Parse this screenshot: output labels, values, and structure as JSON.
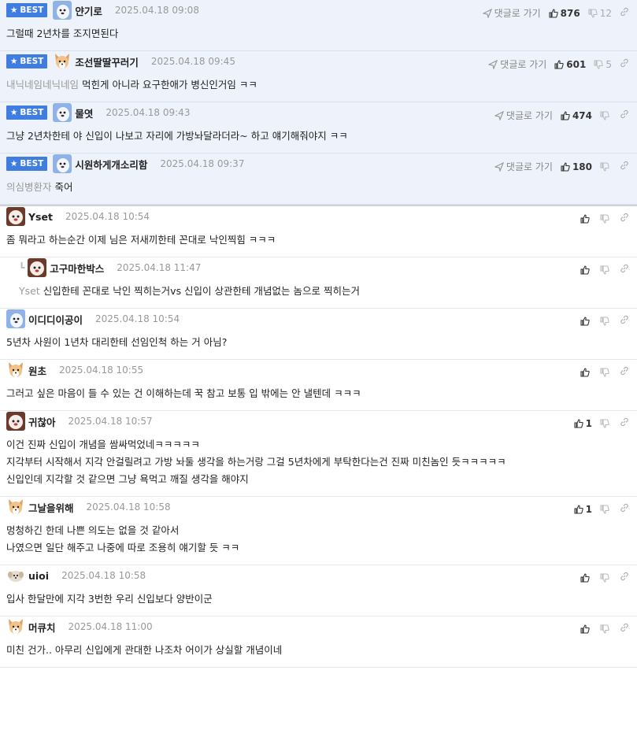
{
  "ui": {
    "best_label": "BEST",
    "goto_label": "댓글로 가기"
  },
  "comments": [
    {
      "best": true,
      "avatar": "blue",
      "nick": "얀기로",
      "date": "2025.04.18 09:08",
      "likes": "876",
      "dislikes": "12",
      "quote": "",
      "lines": [
        "그럴때 2년차를 조지면된다"
      ]
    },
    {
      "best": true,
      "avatar": "dog",
      "nick": "조선딸딸꾸러기",
      "date": "2025.04.18 09:45",
      "likes": "601",
      "dislikes": "5",
      "quote": "내닉네임네닉네임",
      "lines": [
        "먹힌게 아니라 요구한애가 병신인거임 ㅋㅋ"
      ]
    },
    {
      "best": true,
      "avatar": "blue",
      "nick": "물엿",
      "date": "2025.04.18 09:43",
      "likes": "474",
      "dislikes": "",
      "quote": "",
      "lines": [
        "그냥 2년차한테 야 신입이 나보고 자리에 가방놔달라더라~ 하고 얘기해줘야지 ㅋㅋ"
      ]
    },
    {
      "best": true,
      "avatar": "blue",
      "nick": "시원하게개소리함",
      "date": "2025.04.18 09:37",
      "likes": "180",
      "dislikes": "",
      "quote": "의심병환자",
      "lines": [
        "죽어"
      ]
    },
    {
      "best": false,
      "avatar": "poodle",
      "nick": "Yset",
      "date": "2025.04.18 10:54",
      "likes": "",
      "dislikes": "",
      "quote": "",
      "lines": [
        "좀 뭐라고 하는순간 이제 님은 저새끼한테 꼰대로 낙인찍힘 ㅋㅋㅋ"
      ]
    },
    {
      "best": false,
      "reply": true,
      "avatar": "poodle",
      "nick": "고구마한박스",
      "date": "2025.04.18 11:47",
      "likes": "",
      "dislikes": "",
      "quote": "Yset",
      "lines": [
        "신입한테 꼰대로 낙인 찍히는거vs 신입이 상관한테 개념없는 놈으로 찍히는거"
      ]
    },
    {
      "best": false,
      "avatar": "blue",
      "nick": "이디디이공이",
      "date": "2025.04.18 10:54",
      "likes": "",
      "dislikes": "",
      "quote": "",
      "lines": [
        "5년차 사원이 1년차 대리한테 선임인척 하는 거 아님?"
      ]
    },
    {
      "best": false,
      "avatar": "dog",
      "nick": "원초",
      "date": "2025.04.18 10:55",
      "likes": "",
      "dislikes": "",
      "quote": "",
      "lines": [
        "그러고 싶은 마음이 들 수 있는 건 이해하는데 꾹 참고 보통 입 밖에는 안 낼텐데 ㅋㅋㅋ"
      ]
    },
    {
      "best": false,
      "avatar": "poodle",
      "nick": "귀찮아",
      "date": "2025.04.18 10:57",
      "likes": "1",
      "dislikes": "",
      "quote": "",
      "lines": [
        "이건 진짜 신입이 개념을 쌈싸먹었네ㅋㅋㅋㅋㅋ",
        "지각부터 시작해서 지각 안걸릴려고 가방 놔둘 생각을 하는거랑 그걸 5년차에게 부탁한다는건 진짜 미친놈인 듯ㅋㅋㅋㅋㅋ",
        "신입인데 지각할 것 같으면 그냥 욕먹고 깨질 생각을 해야지"
      ]
    },
    {
      "best": false,
      "avatar": "dog",
      "nick": "그날을위해",
      "date": "2025.04.18 10:58",
      "likes": "1",
      "dislikes": "",
      "quote": "",
      "lines": [
        "멍청하긴 한데 나쁜 의도는 없을 것 같아서",
        "나였으면 일단 해주고 나중에 따로 조용히 얘기할 듯 ㅋㅋ"
      ]
    },
    {
      "best": false,
      "avatar": "puppy",
      "nick": "uioi",
      "date": "2025.04.18 10:58",
      "likes": "",
      "dislikes": "",
      "quote": "",
      "lines": [
        "입사 한달만에 지각 3번한 우리 신입보다 양반이군"
      ]
    },
    {
      "best": false,
      "avatar": "dog",
      "nick": "머큐치",
      "date": "2025.04.18 11:00",
      "likes": "",
      "dislikes": "",
      "quote": "",
      "lines": [
        "미친 건가.. 아무리 신입에게 관대한 나조차 어이가 상실할 개념이네"
      ]
    }
  ]
}
